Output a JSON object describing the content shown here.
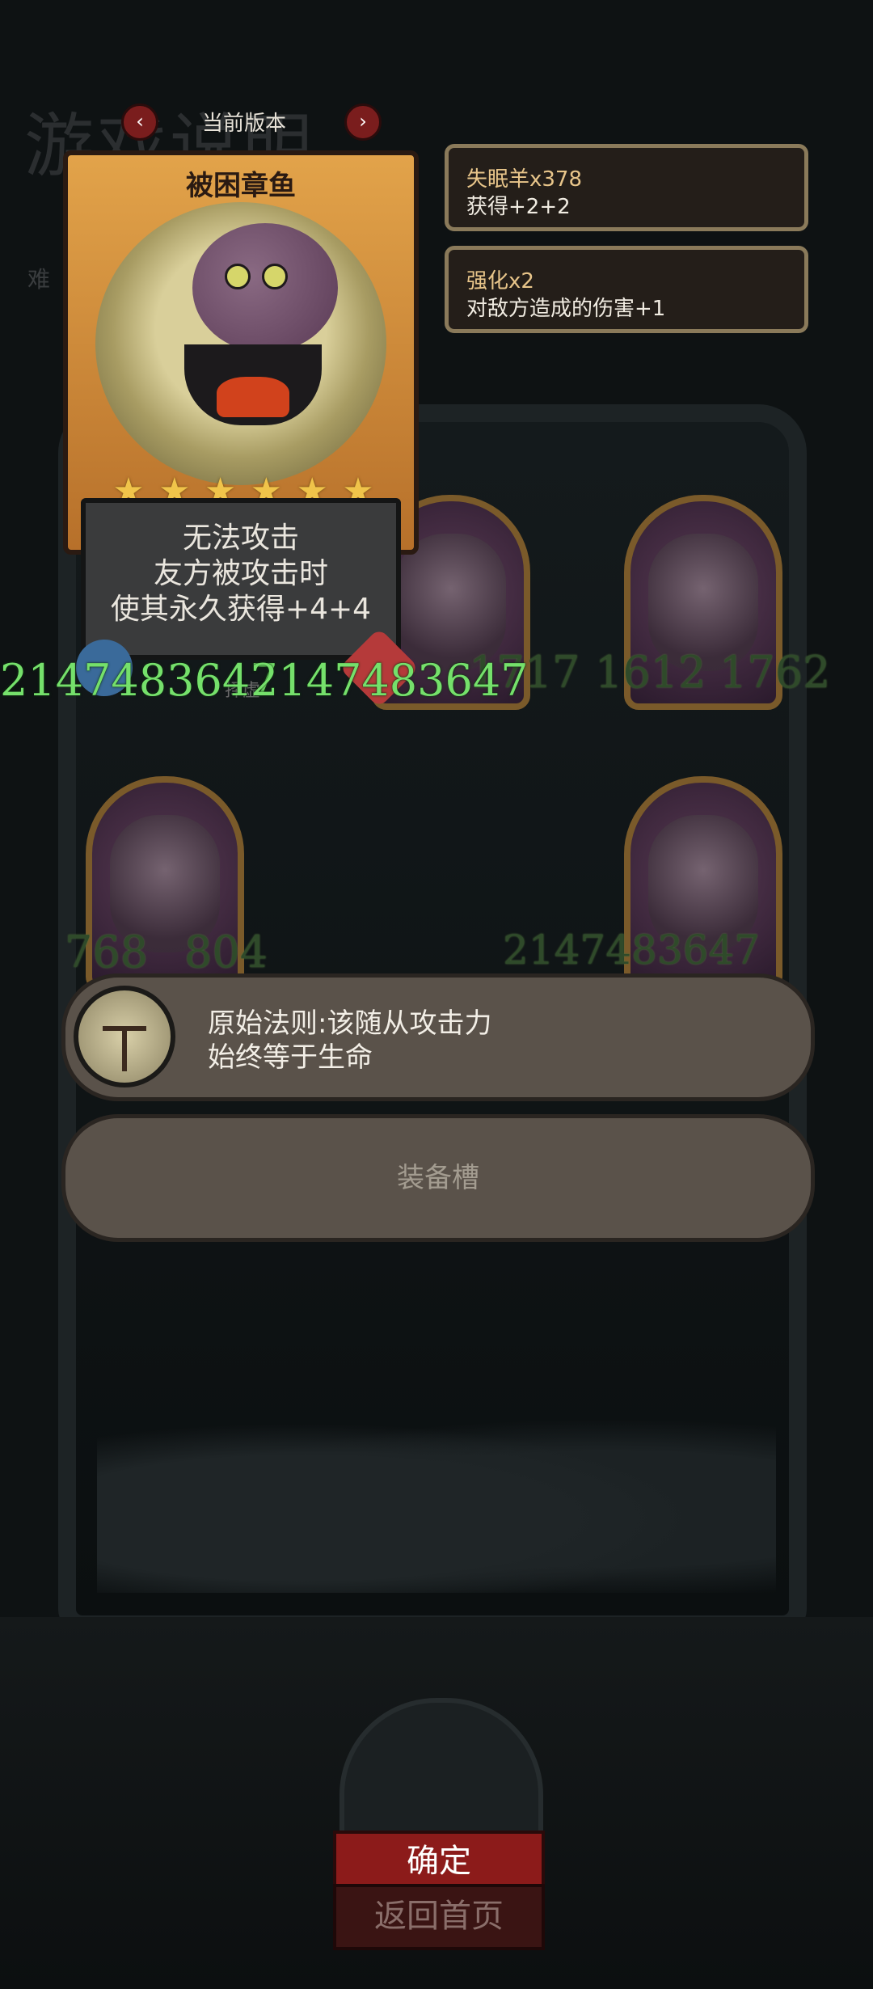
{
  "background": {
    "title": "游戏说明",
    "difficulty_label": "难"
  },
  "version": {
    "label": "当前版本"
  },
  "card": {
    "name": "被困章鱼",
    "stars": 6,
    "description": [
      "无法攻击",
      "友方被攻击时",
      "使其永久获得+4+4"
    ],
    "attack": "2147483647",
    "health": "2147483647",
    "mid_label": "择虚"
  },
  "buffs": [
    {
      "title": "失眠羊x378",
      "desc": "获得+2+2"
    },
    {
      "title": "强化x2",
      "desc": "对敌方造成的伤害+1"
    }
  ],
  "board_units": [
    {
      "atk": "1717",
      "hp": ""
    },
    {
      "atk": "1612",
      "hp": "1762"
    },
    {
      "atk": "768",
      "hp": "804"
    },
    {
      "atk": "2147483647",
      "hp": "2147483647"
    }
  ],
  "rule": {
    "text_line1": "原始法则:该随从攻击力",
    "text_line2": "始终等于生命"
  },
  "equip": {
    "label": "装备槽"
  },
  "buttons": {
    "confirm": "确定",
    "home": "返回首页"
  },
  "colors": {
    "stat_green": "#75e06b",
    "confirm_red": "#8c1b1a",
    "card_gold": "#e2a34a"
  }
}
